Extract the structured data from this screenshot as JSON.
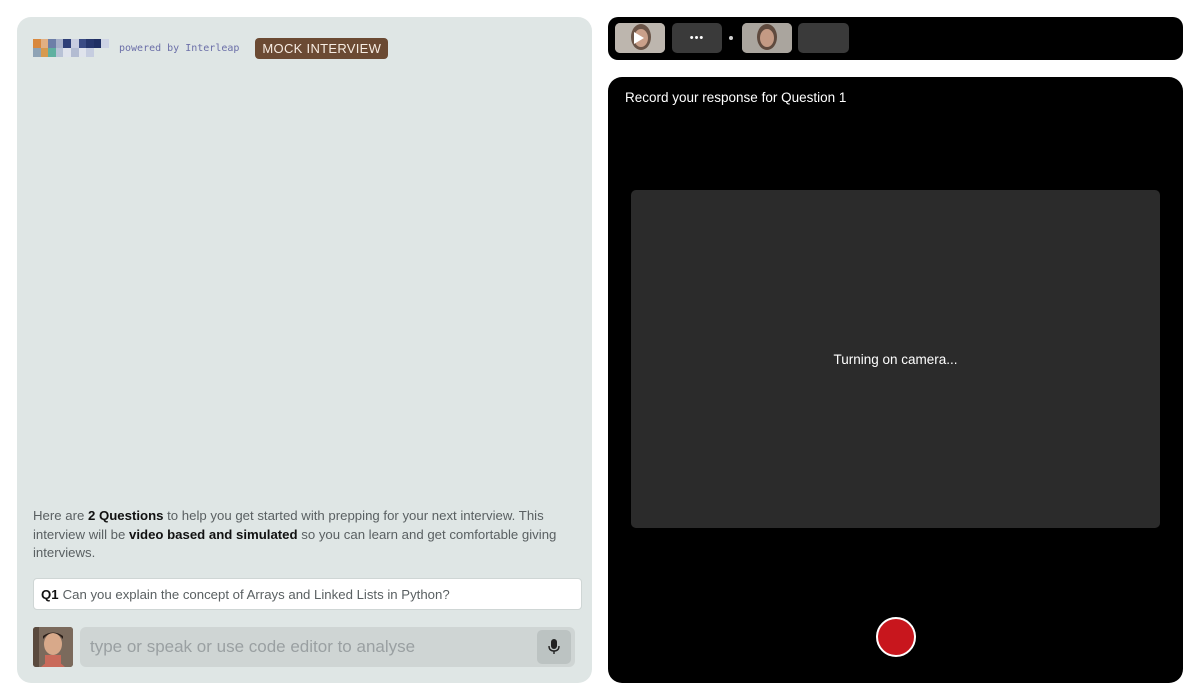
{
  "brand": {
    "powered_by": "powered by Interleap",
    "badge": "MOCK INTERVIEW"
  },
  "intro": {
    "p1": "Here are ",
    "b1": "2 Questions",
    "p2": " to help you get started with prepping for your next interview. This interview will be ",
    "b2": "video based and simulated",
    "p3": " so you can learn and get comfortable giving interviews."
  },
  "question": {
    "number": "Q1",
    "text": "Can you explain the concept of Arrays and Linked Lists in Python?"
  },
  "input": {
    "placeholder": "type or speak or use code editor to analyse"
  },
  "thumbnails": {
    "more_label": "•••"
  },
  "recorder": {
    "title": "Record your response for Question 1",
    "camera_status": "Turning on camera..."
  },
  "colors": {
    "panel_bg": "#dfe6e5",
    "badge_bg": "#6b4a33",
    "record_red": "#c8161d"
  }
}
